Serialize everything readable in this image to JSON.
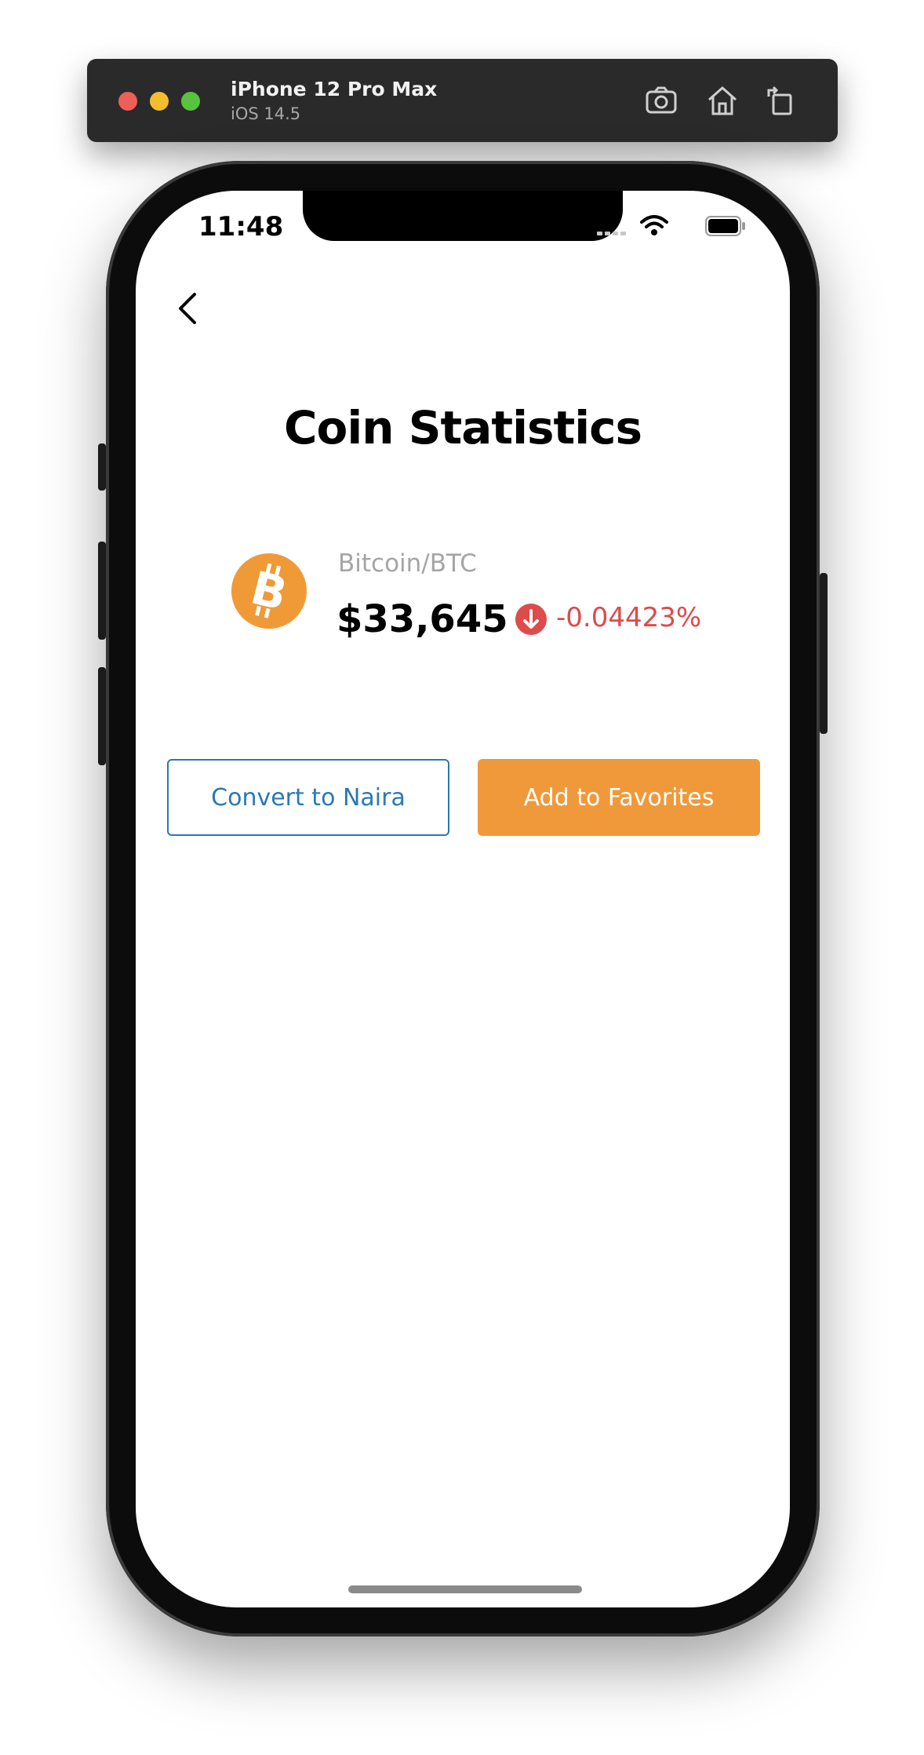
{
  "simulator": {
    "device_name": "iPhone 12 Pro Max",
    "os_version": "iOS 14.5",
    "toolbar_icons": [
      "screenshot-icon",
      "home-icon",
      "rotate-icon"
    ]
  },
  "status_bar": {
    "time": "11:48"
  },
  "page": {
    "title": "Coin Statistics"
  },
  "coin": {
    "name": "Bitcoin/BTC",
    "price": "$33,645",
    "change": "-0.04423%",
    "icon": "bitcoin-icon"
  },
  "actions": {
    "convert_label": "Convert to Naira",
    "favorite_label": "Add to Favorites"
  },
  "colors": {
    "accent_orange": "#f0993a",
    "accent_blue": "#2a79b3",
    "negative_red": "#dd4b4b"
  }
}
